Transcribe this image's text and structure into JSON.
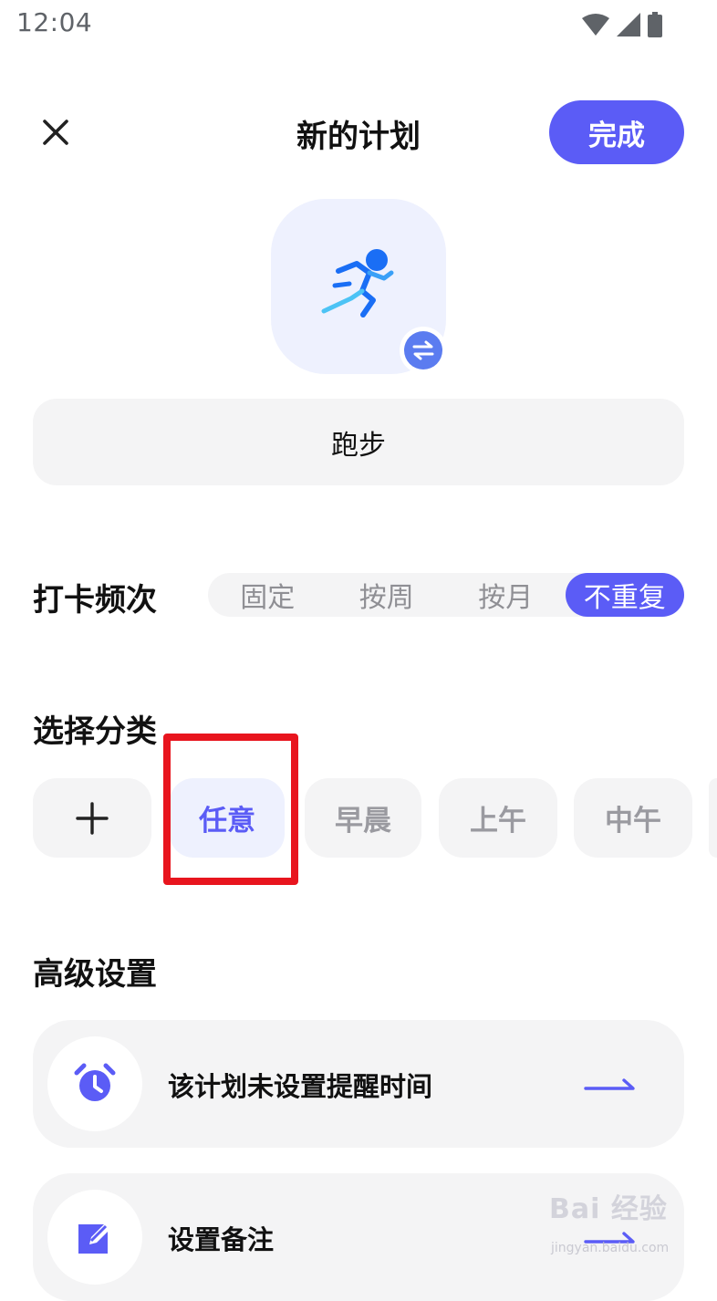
{
  "status_bar": {
    "time": "12:04"
  },
  "header": {
    "title": "新的计划",
    "done_label": "完成"
  },
  "plan": {
    "name": "跑步",
    "icon": "running-person-icon"
  },
  "frequency": {
    "label": "打卡频次",
    "options": [
      "固定",
      "按周",
      "按月",
      "不重复"
    ],
    "selected": "不重复"
  },
  "category": {
    "label": "选择分类",
    "chips": [
      "任意",
      "早晨",
      "上午",
      "中午"
    ],
    "selected": "任意"
  },
  "advanced": {
    "label": "高级设置",
    "items": [
      {
        "text": "该计划未设置提醒时间",
        "icon": "alarm-clock-icon"
      },
      {
        "text": "设置备注",
        "icon": "edit-note-icon"
      }
    ]
  },
  "colors": {
    "accent": "#5b5cf6",
    "chip_bg": "#f4f4f5",
    "highlight": "#e8151e"
  },
  "watermark": {
    "text": "Bai 经验",
    "sub": "jingyan.baidu.com"
  }
}
